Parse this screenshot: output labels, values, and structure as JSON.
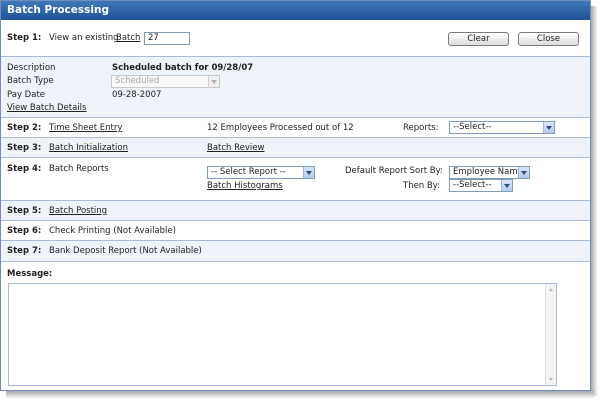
{
  "window": {
    "title": "Batch Processing"
  },
  "colors": {
    "title_bar": "#2a63a8",
    "section_tint": "#eef2f9",
    "border": "#a9bcd6"
  },
  "step1": {
    "step": "Step 1:",
    "text": "View an existing",
    "batch_link": "Batch",
    "batch_value": "27",
    "clear": "Clear",
    "close": "Close"
  },
  "details": {
    "description_label": "Description",
    "description_value": "Scheduled batch for 09/28/07",
    "batch_type_label": "Batch Type",
    "batch_type_value": "Scheduled",
    "pay_date_label": "Pay Date",
    "pay_date_value": "09-28-2007",
    "view_details": "View Batch Details"
  },
  "step2": {
    "step": "Step 2:",
    "link": "Time Sheet Entry",
    "status": "12 Employees Processed out of 12",
    "reports_label": "Reports:",
    "reports_value": "--Select--"
  },
  "step3": {
    "step": "Step 3:",
    "link": "Batch Initialization",
    "review": "Batch Review"
  },
  "step4": {
    "step": "Step 4:",
    "label": "Batch Reports",
    "select_report": "-- Select Report --",
    "histograms": "Batch Histograms",
    "sort_label": "Default Report Sort By:",
    "sort_value": "Employee Name",
    "then_label": "Then By:",
    "then_value": "--Select--"
  },
  "step5": {
    "step": "Step 5:",
    "link": "Batch Posting"
  },
  "step6": {
    "step": "Step 6:",
    "text": "Check Printing (Not Available)"
  },
  "step7": {
    "step": "Step 7:",
    "text": "Bank Deposit Report (Not Available)"
  },
  "message": {
    "label": "Message:",
    "value": ""
  }
}
